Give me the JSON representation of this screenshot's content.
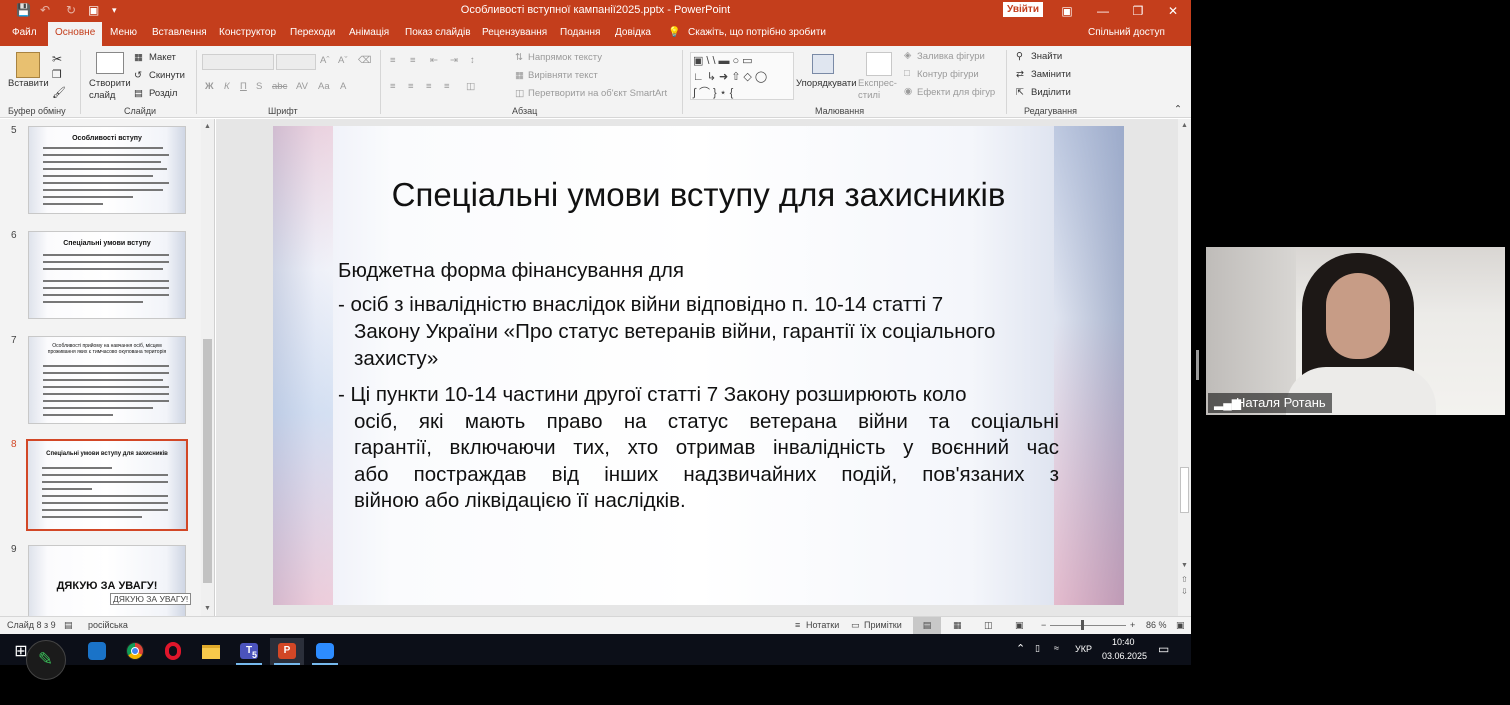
{
  "window": {
    "title": "Особливості вступної кампанії2025.pptx  -  PowerPoint",
    "signin": "Увійти"
  },
  "tabs": [
    "Файл",
    "Основне",
    "Меню",
    "Вставлення",
    "Конструктор",
    "Переходи",
    "Анімація",
    "Показ слайдів",
    "Рецензування",
    "Подання",
    "Довідка"
  ],
  "tell_me": "Скажіть, що потрібно зробити",
  "share": "Спільний доступ",
  "ribbon": {
    "paste": "Вставити",
    "clipboard_group": "Буфер обміну",
    "new_slide": "Створити слайд",
    "layout": "Макет",
    "reset": "Скинути",
    "section": "Розділ",
    "slides_group": "Слайди",
    "font_group": "Шрифт",
    "text_direction": "Напрямок тексту",
    "align_text": "Вирівняти текст",
    "smartart": "Перетворити на об'єкт SmartArt",
    "paragraph_group": "Абзац",
    "arrange": "Упорядкувати",
    "quick_styles": "Експрес-стилі",
    "shape_fill": "Заливка фігури",
    "shape_outline": "Контур фігури",
    "shape_effects": "Ефекти для фігур",
    "drawing_group": "Малювання",
    "find": "Знайти",
    "replace": "Замінити",
    "select": "Виділити",
    "editing_group": "Редагування"
  },
  "thumbnails": [
    {
      "num": "5",
      "title": "Особливості вступу"
    },
    {
      "num": "6",
      "title": "Спеціальні умови вступу"
    },
    {
      "num": "7",
      "title": "Особливості прийому на навчання осіб, місцем проживання яких є тимчасово окупована територія"
    },
    {
      "num": "8",
      "title": "Спеціальні умови вступу для захисників"
    },
    {
      "num": "9",
      "title": "ДЯКУЮ ЗА УВАГУ!"
    }
  ],
  "tooltip": "ДЯКУЮ ЗА УВАГУ!",
  "slide": {
    "title": "Спеціальні умови вступу для захисників",
    "intro": "Бюджетна форма фінансування для",
    "bullet1_l1": "-  осіб з інвалідністю внаслідок війни відповідно п. 10-14 статті 7",
    "bullet1_l2": "Закону України «Про статус ветеранів війни, гарантії їх соціального",
    "bullet1_l3": "захисту»",
    "bullet2_l1": "-   Ці пункти 10-14 частини другої статті 7 Закону розширюють коло",
    "bullet2_l2": "осіб, які мають право на статус ветерана війни та соціальні",
    "bullet2_l3": "гарантії, включаючи тих, хто отримав інвалідність у воєнний час",
    "bullet2_l4": "або постраждав від інших надзвичайних подій, пов'язаних з",
    "bullet2_l5": "війною або ліквідацією її наслідків."
  },
  "status": {
    "slide_of": "Слайд 8 з 9",
    "language": "російська",
    "notes": "Нотатки",
    "comments": "Примітки",
    "zoom": "86 %"
  },
  "taskbar": {
    "teams_badge": "5",
    "lang": "УКР",
    "time": "10:40",
    "date": "03.06.2025"
  },
  "video": {
    "participant": "Наталя Ротань"
  },
  "colors": {
    "accent": "#c43e1c",
    "selected_thumb": "#d24726"
  }
}
